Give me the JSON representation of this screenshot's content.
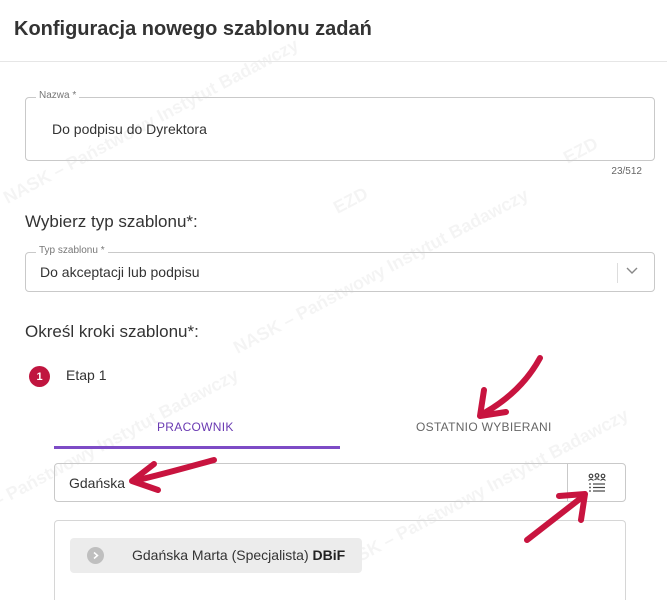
{
  "header": {
    "title": "Konfiguracja nowego szablonu zadań"
  },
  "watermark": {
    "text": "NASK – Państwowy Instytut Badawczy",
    "logo": "EZD"
  },
  "name_field": {
    "label": "Nazwa *",
    "value": "Do podpisu do Dyrektora",
    "counter": "23/512"
  },
  "template_type": {
    "heading": "Wybierz typ szablonu*:",
    "label": "Typ szablonu *",
    "value": "Do akceptacji lub podpisu"
  },
  "steps": {
    "heading": "Określ kroki szablonu*:",
    "items": [
      {
        "number": "1",
        "label": "Etap 1"
      }
    ]
  },
  "tabs": [
    {
      "label": "PRACOWNIK",
      "active": true
    },
    {
      "label": "OSTATNIO WYBIERANI",
      "active": false
    }
  ],
  "search": {
    "value": "Gdańska",
    "button_icon": "people-list-icon"
  },
  "results": [
    {
      "name": "Gdańska Marta (Specjalista)",
      "dept": "DBiF"
    }
  ],
  "colors": {
    "accent": "#7d4bc6",
    "badge": "#c0153f",
    "arrow": "#c8143f"
  }
}
